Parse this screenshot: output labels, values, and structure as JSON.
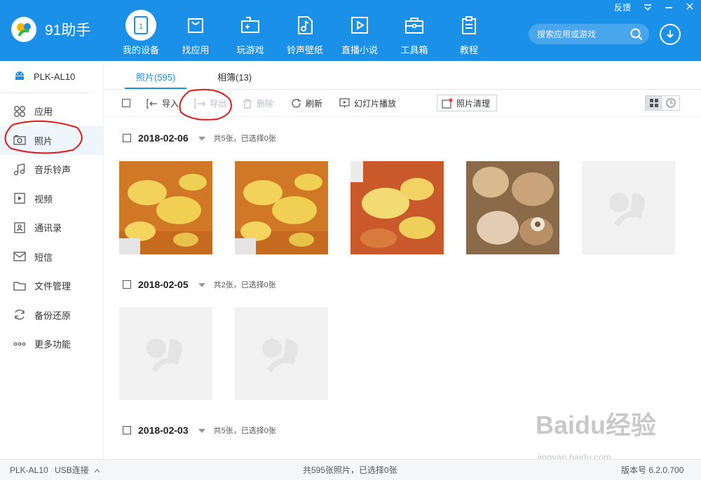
{
  "app": {
    "name": "91助手",
    "brand_color": "#1a90e8"
  },
  "window_controls": {
    "feedback": "反馈",
    "menu": "menu-icon",
    "minimize": "minimize-icon",
    "close": "close-icon"
  },
  "nav": [
    {
      "label": "我的设备",
      "icon": "tablet-icon",
      "active": true
    },
    {
      "label": "找应用",
      "icon": "bag-icon"
    },
    {
      "label": "玩游戏",
      "icon": "gamepad-icon"
    },
    {
      "label": "铃声壁纸",
      "icon": "music-file-icon"
    },
    {
      "label": "直播小说",
      "icon": "play-icon"
    },
    {
      "label": "工具箱",
      "icon": "toolbox-icon"
    },
    {
      "label": "教程",
      "icon": "clipboard-icon"
    }
  ],
  "search": {
    "placeholder": "搜索应用或游戏"
  },
  "sidebar": {
    "device": "PLK-AL10",
    "items": [
      {
        "label": "应用",
        "icon": "apps-icon"
      },
      {
        "label": "照片",
        "icon": "camera-icon",
        "active": true
      },
      {
        "label": "音乐铃声",
        "icon": "music-icon"
      },
      {
        "label": "视频",
        "icon": "video-icon"
      },
      {
        "label": "通讯录",
        "icon": "contacts-icon"
      },
      {
        "label": "短信",
        "icon": "message-icon"
      },
      {
        "label": "文件管理",
        "icon": "folder-icon"
      },
      {
        "label": "备份还原",
        "icon": "refresh-icon"
      },
      {
        "label": "更多功能",
        "icon": "more-icon"
      }
    ]
  },
  "tabs": [
    {
      "label": "照片(595)",
      "active": true
    },
    {
      "label": "相簿(13)"
    }
  ],
  "toolbar": {
    "import": "导入",
    "export": "导出",
    "delete": "删除",
    "refresh": "刷新",
    "slideshow": "幻灯片播放",
    "clean": "照片清理"
  },
  "groups": [
    {
      "date": "2018-02-06",
      "count": "共5张，已选择0张"
    },
    {
      "date": "2018-02-05",
      "count": "共2张，已选择0张"
    },
    {
      "date": "2018-02-03",
      "count": "共5张，已选择0张"
    }
  ],
  "statusbar": {
    "device": "PLK-AL10",
    "connection": "USB连接",
    "summary": "共595张照片，已选择0张",
    "version": "版本号 6.2.0.700"
  },
  "watermark": {
    "main": "Baidu经验",
    "sub": "jingyan.baidu.com"
  }
}
